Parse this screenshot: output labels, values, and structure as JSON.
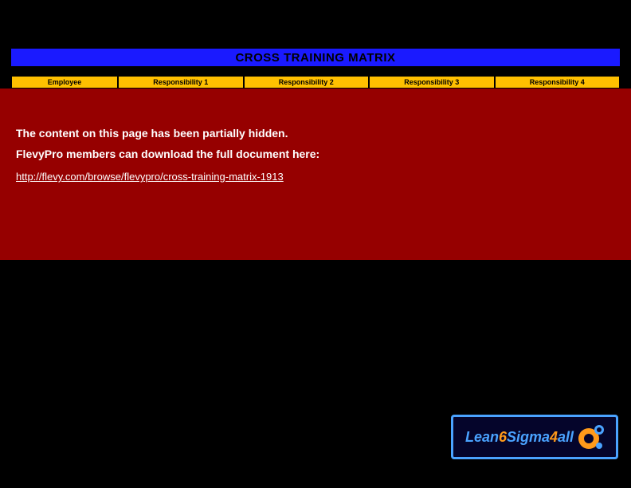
{
  "title": "CROSS TRAINING MATRIX",
  "headers": {
    "employee": "Employee",
    "resp1": "Responsibility 1",
    "resp2": "Responsibility 2",
    "resp3": "Responsibility 3",
    "resp4": "Responsibility 4"
  },
  "overlay": {
    "line1": "The content on this page has been partially hidden.",
    "line2": "FlevyPro members can download the full document here:",
    "link_text": "http://flevy.com/browse/flevypro/cross-training-matrix-1913"
  },
  "logo": {
    "part1": "Lean",
    "part2": "6",
    "part3": "Sigma",
    "part4": "4",
    "part5": "all"
  }
}
